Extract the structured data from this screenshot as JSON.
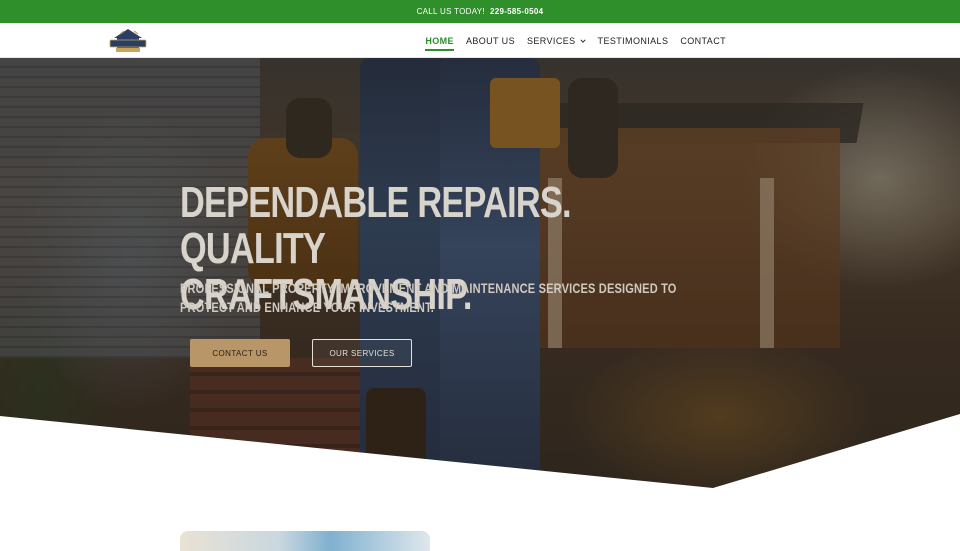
{
  "topbar": {
    "call_label": "CALL US TODAY!",
    "phone": "229-585-0504"
  },
  "brand": {
    "logo_name": "EDMONDSON",
    "logo_tag": "HOME SERVICES"
  },
  "nav": {
    "items": [
      {
        "label": "HOME",
        "active": true
      },
      {
        "label": "ABOUT US",
        "active": false
      },
      {
        "label": "SERVICES",
        "active": false,
        "has_dropdown": true
      },
      {
        "label": "TESTIMONIALS",
        "active": false
      },
      {
        "label": "CONTACT",
        "active": false
      }
    ]
  },
  "hero": {
    "title": "Dependable Repairs. Quality Craftsmanship.",
    "subtitle": "Professional property improvement and maintenance services designed to protect and enhance your investment.",
    "primary_button": "CONTACT US",
    "secondary_button": "OUR SERVICES"
  },
  "colors": {
    "brand_green": "#2f8f2a",
    "button_tan": "#b89668"
  },
  "icons": {
    "dropdown": "chevron-down-icon"
  }
}
